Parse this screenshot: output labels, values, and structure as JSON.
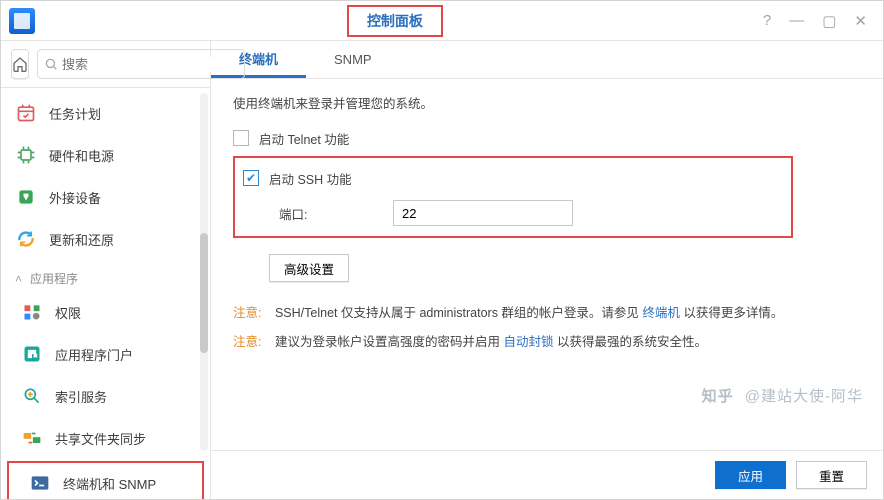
{
  "window": {
    "title": "控制面板"
  },
  "search": {
    "placeholder": "搜索"
  },
  "sidebar": {
    "items": [
      {
        "label": "任务计划"
      },
      {
        "label": "硬件和电源"
      },
      {
        "label": "外接设备"
      },
      {
        "label": "更新和还原"
      }
    ],
    "group_label": "应用程序",
    "apps": [
      {
        "label": "权限"
      },
      {
        "label": "应用程序门户"
      },
      {
        "label": "索引服务"
      },
      {
        "label": "共享文件夹同步"
      },
      {
        "label": "终端机和 SNMP"
      }
    ]
  },
  "tabs": [
    {
      "label": "终端机",
      "active": true
    },
    {
      "label": "SNMP",
      "active": false
    }
  ],
  "content": {
    "desc": "使用终端机来登录并管理您的系统。",
    "telnet_label": "启动 Telnet 功能",
    "ssh_label": "启动 SSH 功能",
    "port_label": "端口:",
    "port_value": "22",
    "adv_label": "高级设置",
    "note1_label": "注意:",
    "note1_a": "SSH/Telnet 仅支持从属于 administrators 群组的帐户登录。请参见 ",
    "note1_link": "终端机",
    "note1_b": " 以获得更多详情。",
    "note2_label": "注意:",
    "note2_a": "建议为登录帐户设置高强度的密码并启用 ",
    "note2_link": "自动封锁",
    "note2_b": " 以获得最强的系统安全性。"
  },
  "footer": {
    "apply": "应用",
    "reset": "重置"
  },
  "watermark": {
    "brand": "知乎",
    "text": "@建站大使-阿华"
  }
}
